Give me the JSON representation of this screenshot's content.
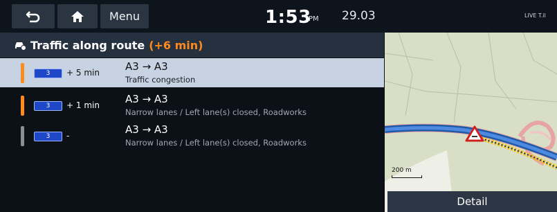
{
  "topbar": {
    "menu_label": "Menu",
    "time": "1:53",
    "ampm": "PM",
    "date": "29.03",
    "status_text": "LIVE T.il"
  },
  "traffic": {
    "title": "Traffic along route",
    "extra_delay": "(+6 min)",
    "rows": [
      {
        "road_number": "3",
        "delay": "+ 5 min",
        "route": "A3 → A3",
        "description": "Traffic congestion",
        "severity_color": "#ff8a1e"
      },
      {
        "road_number": "3",
        "delay": "+ 1 min",
        "route": "A3 → A3",
        "description": "Narrow lanes / Left lane(s) closed, Roadworks",
        "severity_color": "#ff8a1e"
      },
      {
        "road_number": "3",
        "delay": "-",
        "route": "A3 → A3",
        "description": "Narrow lanes / Left lane(s) closed, Roadworks",
        "severity_color": "#8a8f96"
      }
    ]
  },
  "map": {
    "scale_label": "200 m",
    "detail_label": "Detail"
  },
  "icons": {
    "back": "back-arrow-icon",
    "home": "home-icon",
    "traffic": "car-traffic-icon",
    "warning": "warning-triangle-icon"
  }
}
